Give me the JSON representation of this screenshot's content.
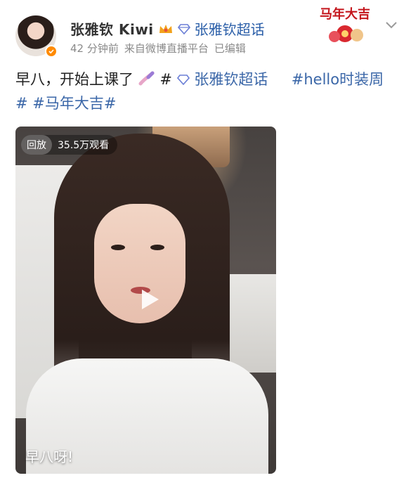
{
  "post": {
    "username": "张雅钦 Kiwi",
    "supertopic_label": "张雅钦超话",
    "time": "42 分钟前",
    "source": "来自微博直播平台",
    "edited": "已编辑",
    "badge_text": "马年大吉",
    "text": {
      "main": "早八，开始上课了",
      "hash1": "#",
      "tag_supertopic": "张雅钦超话",
      "tag_hello": "#hello时装周",
      "hash2": "#",
      "tag_horse": "#马年大吉#"
    }
  },
  "video": {
    "replay_label": "回放",
    "views": "35.5万观看",
    "caption": "早八呀!"
  },
  "colors": {
    "link": "#3b67a8",
    "meta": "#8a8a8a",
    "verified_badge": "#ff8a00"
  }
}
